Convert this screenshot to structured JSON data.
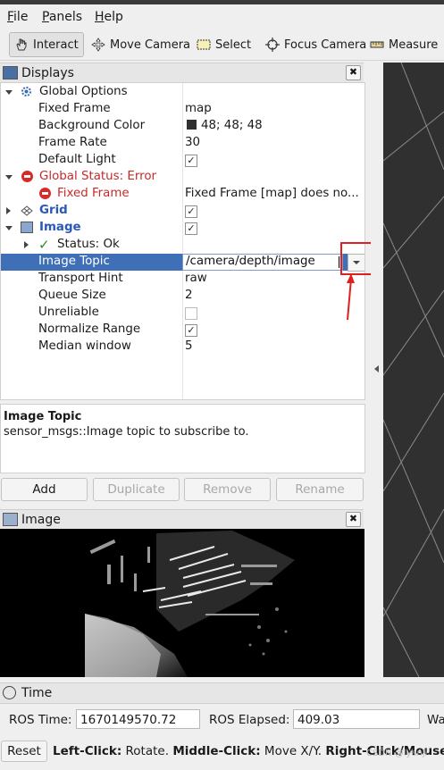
{
  "menubar": {
    "items": [
      {
        "label": "File",
        "u": "F",
        "rest": "ile"
      },
      {
        "label": "Panels",
        "u": "P",
        "rest": "anels"
      },
      {
        "label": "Help",
        "u": "H",
        "rest": "elp"
      }
    ]
  },
  "toolbar": {
    "interact": "Interact",
    "move_camera": "Move Camera",
    "select": "Select",
    "focus_camera": "Focus Camera",
    "measure": "Measure"
  },
  "displays": {
    "title": "Displays",
    "close": "✖",
    "rows": {
      "global_options": "Global Options",
      "fixed_frame_label": "Fixed Frame",
      "fixed_frame_value": "map",
      "background_color_label": "Background Color",
      "background_color_value": "48; 48; 48",
      "frame_rate_label": "Frame Rate",
      "frame_rate_value": "30",
      "default_light_label": "Default Light",
      "global_status": "Global Status: Error",
      "fixed_frame_err_label": "Fixed Frame",
      "fixed_frame_err_value": "Fixed Frame [map] does no...",
      "grid": "Grid",
      "image": "Image",
      "status_ok": "Status: Ok",
      "image_topic_label": "Image Topic",
      "image_topic_value": "/camera/depth/image",
      "transport_hint_label": "Transport Hint",
      "transport_hint_value": "raw",
      "queue_size_label": "Queue Size",
      "queue_size_value": "2",
      "unreliable_label": "Unreliable",
      "normalize_range_label": "Normalize Range",
      "median_window_label": "Median window",
      "median_window_value": "5"
    },
    "check_mark": "✓"
  },
  "description": {
    "heading": "Image Topic",
    "text": "sensor_msgs::Image topic to subscribe to."
  },
  "buttons": {
    "add": "Add",
    "duplicate": "Duplicate",
    "remove": "Remove",
    "rename": "Rename"
  },
  "image_panel": {
    "title": "Image",
    "close": "✖"
  },
  "time_panel": {
    "title": "Time",
    "ros_time_label": "ROS Time:",
    "ros_time_value": "1670149570.72",
    "ros_elapsed_label": "ROS Elapsed:",
    "ros_elapsed_value": "409.03",
    "wall_label_partial": "Wa"
  },
  "statusbar": {
    "reset": "Reset",
    "left_click_label": "Left-Click:",
    "left_click_text": " Rotate. ",
    "middle_click_label": "Middle-Click:",
    "middle_click_text": " Move X/Y. ",
    "right_click_label": "Right-Click/Mouse"
  },
  "watermark": "CSDN @lyanji",
  "colors": {
    "selection": "#3f6fb6",
    "error": "#c52a2a",
    "annotation": "#e02020",
    "view_bg": "#303030"
  }
}
